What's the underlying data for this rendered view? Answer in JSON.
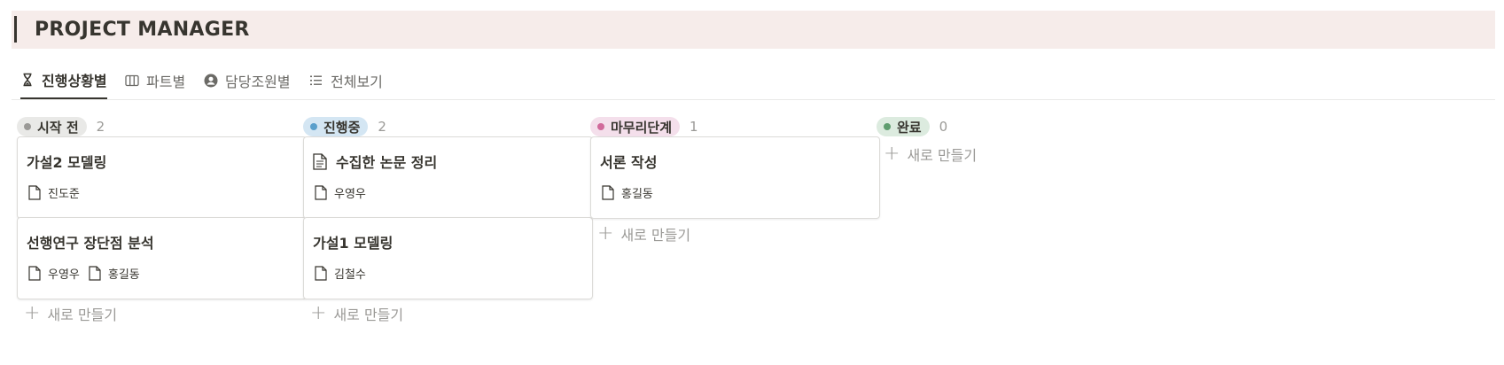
{
  "header": {
    "title": "PROJECT MANAGER"
  },
  "tabs": [
    {
      "label": "진행상황별",
      "icon": "hourglass-icon",
      "active": true
    },
    {
      "label": "파트별",
      "icon": "columns-icon",
      "active": false
    },
    {
      "label": "담당조원별",
      "icon": "person-circle-icon",
      "active": false
    },
    {
      "label": "전체보기",
      "icon": "list-icon",
      "active": false
    }
  ],
  "colors": {
    "not_started": "#9b9a97",
    "not_started_bg": "#e9e9e7",
    "in_progress": "#5a9fcb",
    "in_progress_bg": "#d4e6f3",
    "finishing": "#d16a9b",
    "finishing_bg": "#f4dfeb",
    "done": "#5f9d6f",
    "done_bg": "#dcebdf"
  },
  "new_label": "새로 만들기",
  "columns": [
    {
      "status": "시작 전",
      "count": "2",
      "cards": [
        {
          "title": "가설2 모델링",
          "people": [
            "진도준"
          ]
        },
        {
          "title": "선행연구 장단점 분석",
          "people": [
            "우영우",
            "홍길동"
          ]
        }
      ]
    },
    {
      "status": "진행중",
      "count": "2",
      "cards": [
        {
          "title": "수집한 논문 정리",
          "people": [
            "우영우"
          ]
        },
        {
          "title": "가설1 모델링",
          "people": [
            "김철수"
          ]
        }
      ]
    },
    {
      "status": "마무리단계",
      "count": "1",
      "cards": [
        {
          "title": "서론 작성",
          "people": [
            "홍길동"
          ]
        }
      ]
    },
    {
      "status": "완료",
      "count": "0",
      "cards": []
    }
  ]
}
